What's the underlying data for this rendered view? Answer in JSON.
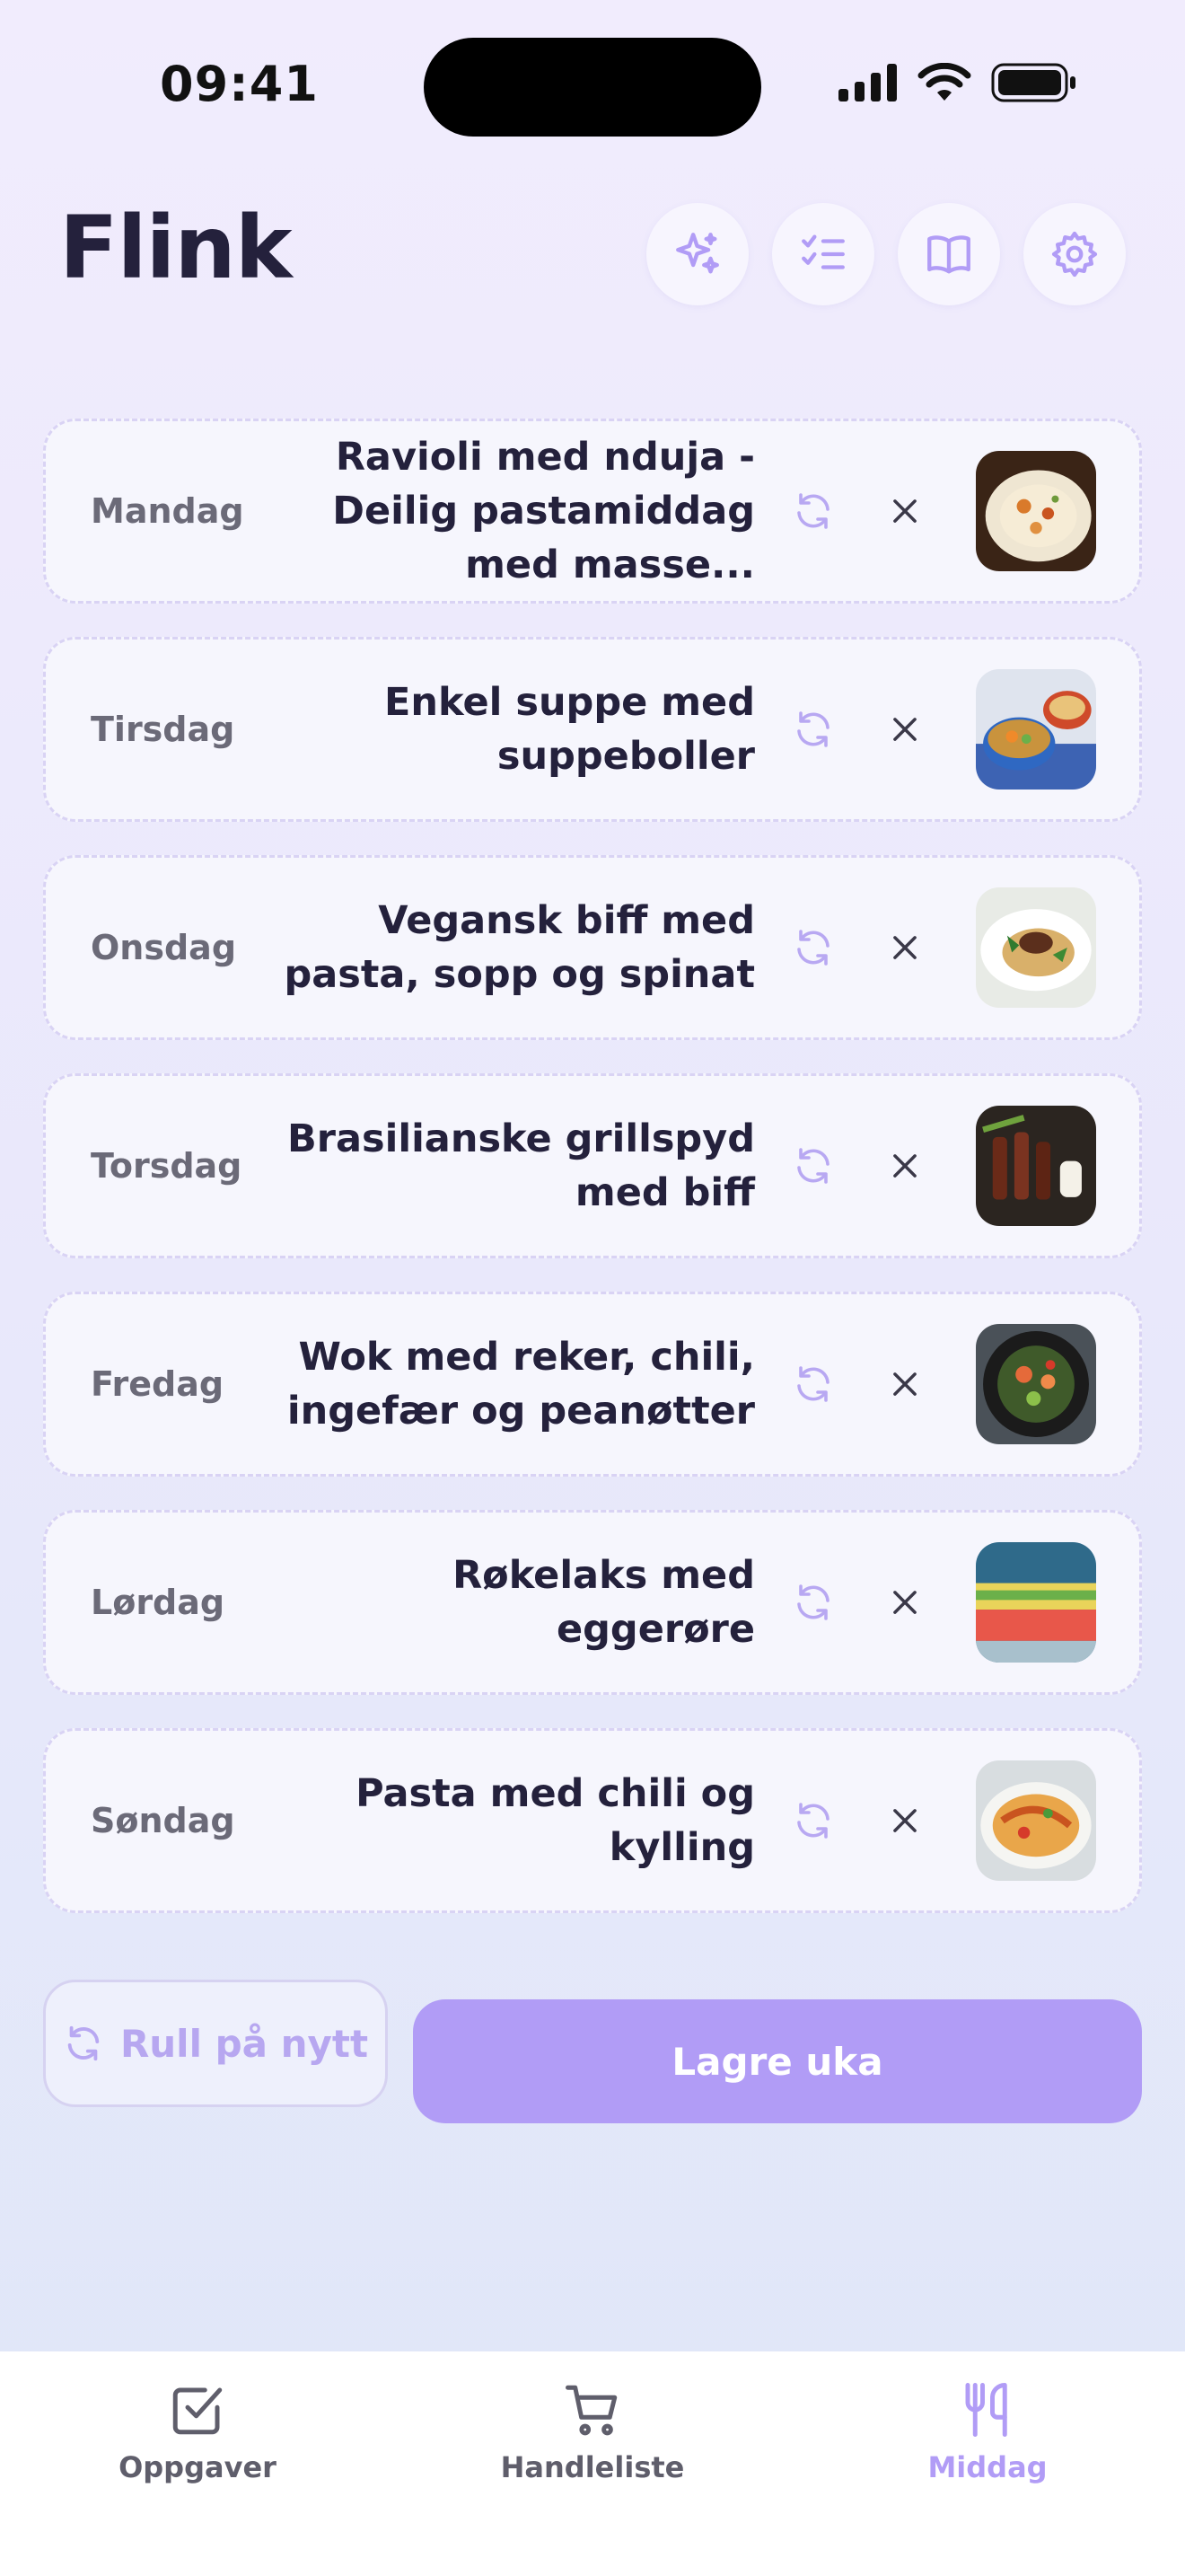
{
  "status": {
    "time": "09:41"
  },
  "app": {
    "title": "Flink"
  },
  "header_icons": [
    "sparkles-icon",
    "checklist-icon",
    "book-icon",
    "gear-icon"
  ],
  "days": [
    {
      "day": "Mandag",
      "dish": "Ravioli med nduja - Deilig pastamiddag med masse...",
      "photo": "ravioli"
    },
    {
      "day": "Tirsdag",
      "dish": "Enkel suppe med suppeboller",
      "photo": "soup"
    },
    {
      "day": "Onsdag",
      "dish": "Vegansk biff med pasta, sopp og spinat",
      "photo": "vegan-steak"
    },
    {
      "day": "Torsdag",
      "dish": "Brasilianske grillspyd med biff",
      "photo": "skewers"
    },
    {
      "day": "Fredag",
      "dish": "Wok med reker, chili, ingefær og peanøtter",
      "photo": "wok"
    },
    {
      "day": "Lørdag",
      "dish": "Røkelaks med eggerøre",
      "photo": "salmon"
    },
    {
      "day": "Søndag",
      "dish": "Pasta med chili og kylling",
      "photo": "pasta"
    }
  ],
  "actions": {
    "reroll_label": "Rull på nytt",
    "save_label": "Lagre uka"
  },
  "nav": {
    "items": [
      {
        "label": "Oppgaver",
        "icon": "checkbox-icon"
      },
      {
        "label": "Handleliste",
        "icon": "cart-icon"
      },
      {
        "label": "Middag",
        "icon": "fork-knife-icon"
      }
    ],
    "active": "Middag"
  },
  "colors": {
    "accent": "#b19cf6",
    "text": "#24213c",
    "muted": "#6b6a78"
  }
}
